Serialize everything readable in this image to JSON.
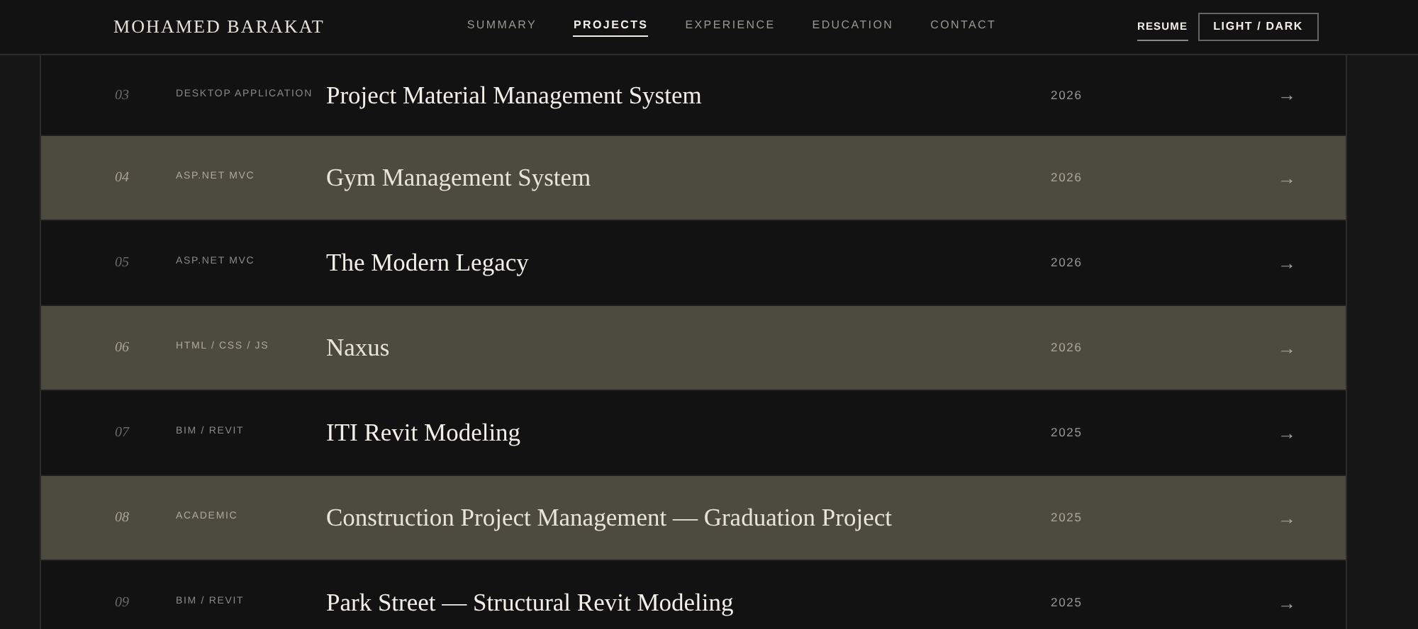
{
  "header": {
    "brand": "MOHAMED BARAKAT",
    "nav": [
      {
        "label": "SUMMARY",
        "selected": false
      },
      {
        "label": "PROJECTS",
        "selected": true
      },
      {
        "label": "EXPERIENCE",
        "selected": false
      },
      {
        "label": "EDUCATION",
        "selected": false
      },
      {
        "label": "CONTACT",
        "selected": false
      }
    ],
    "resume": "RESUME",
    "theme_toggle": "LIGHT / DARK"
  },
  "projects": [
    {
      "number": "03",
      "category": "DESKTOP APPLICATION",
      "title": "Project Material Management System",
      "year": "2026",
      "arrow": "→",
      "highlighted": false
    },
    {
      "number": "04",
      "category": "ASP.NET MVC",
      "title": "Gym Management System",
      "year": "2026",
      "arrow": "→",
      "highlighted": true
    },
    {
      "number": "05",
      "category": "ASP.NET MVC",
      "title": "The Modern Legacy",
      "year": "2026",
      "arrow": "→",
      "highlighted": false
    },
    {
      "number": "06",
      "category": "HTML / CSS / JS",
      "title": "Naxus",
      "year": "2026",
      "arrow": "→",
      "highlighted": true
    },
    {
      "number": "07",
      "category": "BIM / REVIT",
      "title": "ITI Revit Modeling",
      "year": "2025",
      "arrow": "→",
      "highlighted": false
    },
    {
      "number": "08",
      "category": "ACADEMIC",
      "title": "Construction Project Management — Graduation Project",
      "year": "2025",
      "arrow": "→",
      "highlighted": true
    },
    {
      "number": "09",
      "category": "BIM / REVIT",
      "title": "Park Street — Structural Revit Modeling",
      "year": "2025",
      "arrow": "→",
      "highlighted": false
    }
  ]
}
